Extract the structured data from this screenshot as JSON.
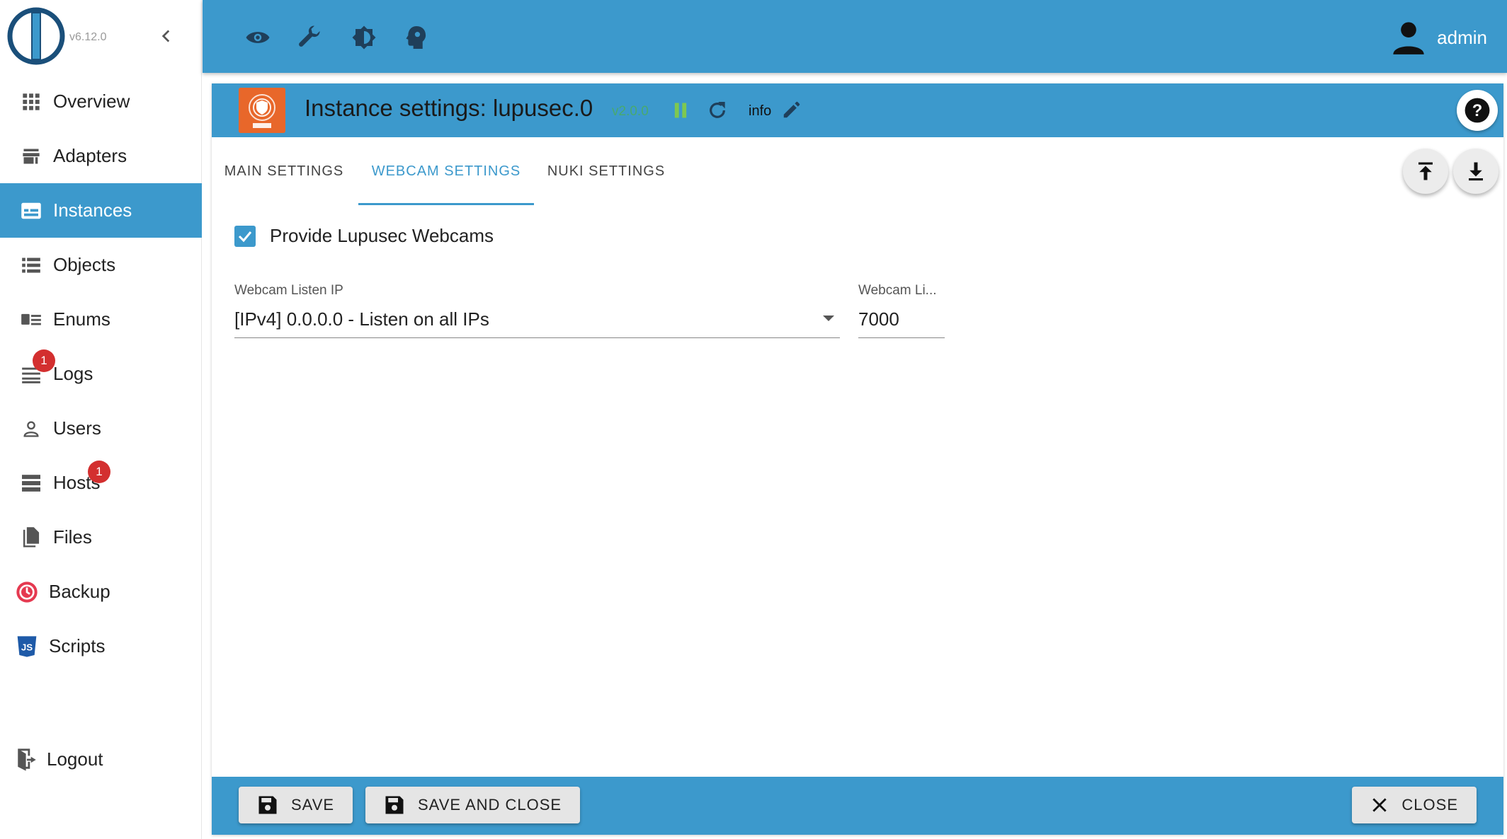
{
  "app": {
    "version": "v6.12.0",
    "user": "admin"
  },
  "sidebar": {
    "items": [
      {
        "label": "Overview",
        "icon": "grid-icon"
      },
      {
        "label": "Adapters",
        "icon": "store-icon"
      },
      {
        "label": "Instances",
        "icon": "instances-icon",
        "active": true
      },
      {
        "label": "Objects",
        "icon": "list-icon"
      },
      {
        "label": "Enums",
        "icon": "enums-icon"
      },
      {
        "label": "Logs",
        "icon": "logs-icon",
        "badge": "1"
      },
      {
        "label": "Users",
        "icon": "user-icon"
      },
      {
        "label": "Hosts",
        "icon": "hosts-icon",
        "badge": "1"
      },
      {
        "label": "Files",
        "icon": "files-icon"
      },
      {
        "label": "Backup",
        "icon": "backup-icon"
      },
      {
        "label": "Scripts",
        "icon": "js-icon"
      }
    ],
    "logout": "Logout"
  },
  "panel": {
    "title": "Instance settings: lupusec.0",
    "adapter_version": "v2.0.0",
    "info_label": "info",
    "tabs": [
      "MAIN SETTINGS",
      "WEBCAM SETTINGS",
      "NUKI SETTINGS"
    ],
    "active_tab": 1
  },
  "webcam": {
    "provide_label": "Provide Lupusec Webcams",
    "provide_checked": true,
    "listen_ip_label": "Webcam Listen IP",
    "listen_ip_value": "[IPv4] 0.0.0.0 - Listen on all IPs",
    "port_label": "Webcam Li...",
    "port_value": "7000"
  },
  "footer": {
    "save": "SAVE",
    "save_close": "SAVE AND CLOSE",
    "close": "CLOSE"
  },
  "colors": {
    "primary": "#3c99cc",
    "badge": "#d32f2f",
    "adapter_logo": "#e8672a",
    "version_green": "#4caf50"
  }
}
